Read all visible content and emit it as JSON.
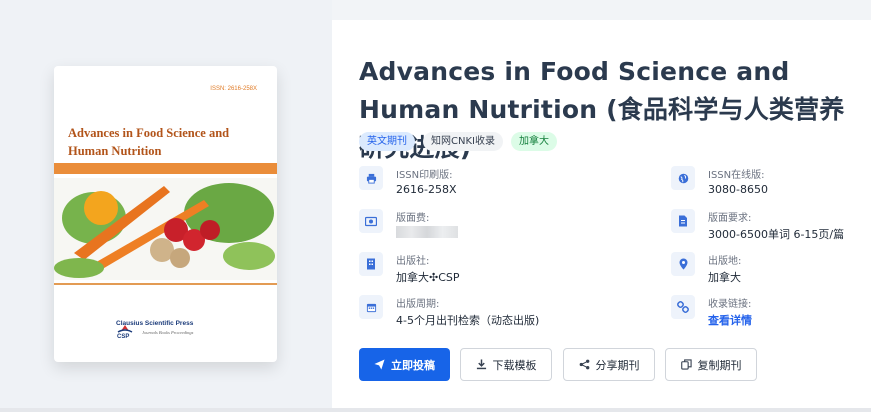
{
  "cover": {
    "issn_text": "ISSN: 2616-258X",
    "title": "Advances in Food Science and Human Nutrition",
    "press_name": "Clausius Scientific Press",
    "press_tagline": "Journals Books Proceedings",
    "logo_text": "CSP"
  },
  "journal": {
    "title": "Advances in Food Science and Human Nutrition (食品科学与人类营养研究进展)",
    "tags": [
      "英文期刊",
      "知网CNKI收录",
      "加拿大"
    ]
  },
  "info": {
    "issn_print": {
      "label": "ISSN印刷版:",
      "value": "2616-258X"
    },
    "issn_online": {
      "label": "ISSN在线版:",
      "value": "3080-8650"
    },
    "page_fee": {
      "label": "版面费:",
      "value": ""
    },
    "page_req": {
      "label": "版面要求:",
      "value": "3000-6500单词 6-15页/篇"
    },
    "publisher": {
      "label": "出版社:",
      "value": "加拿大✣CSP"
    },
    "place": {
      "label": "出版地:",
      "value": "加拿大"
    },
    "cycle": {
      "label": "出版周期:",
      "value": "4-5个月出刊检索（动态出版)"
    },
    "index_link": {
      "label": "收录链接:",
      "value": "查看详情"
    }
  },
  "actions": {
    "submit": "立即投稿",
    "download": "下载模板",
    "share": "分享期刊",
    "copy": "复制期刊"
  },
  "colors": {
    "primary": "#1764e8",
    "cover_orange": "#ea8d3a",
    "title": "#2b3a4e"
  }
}
